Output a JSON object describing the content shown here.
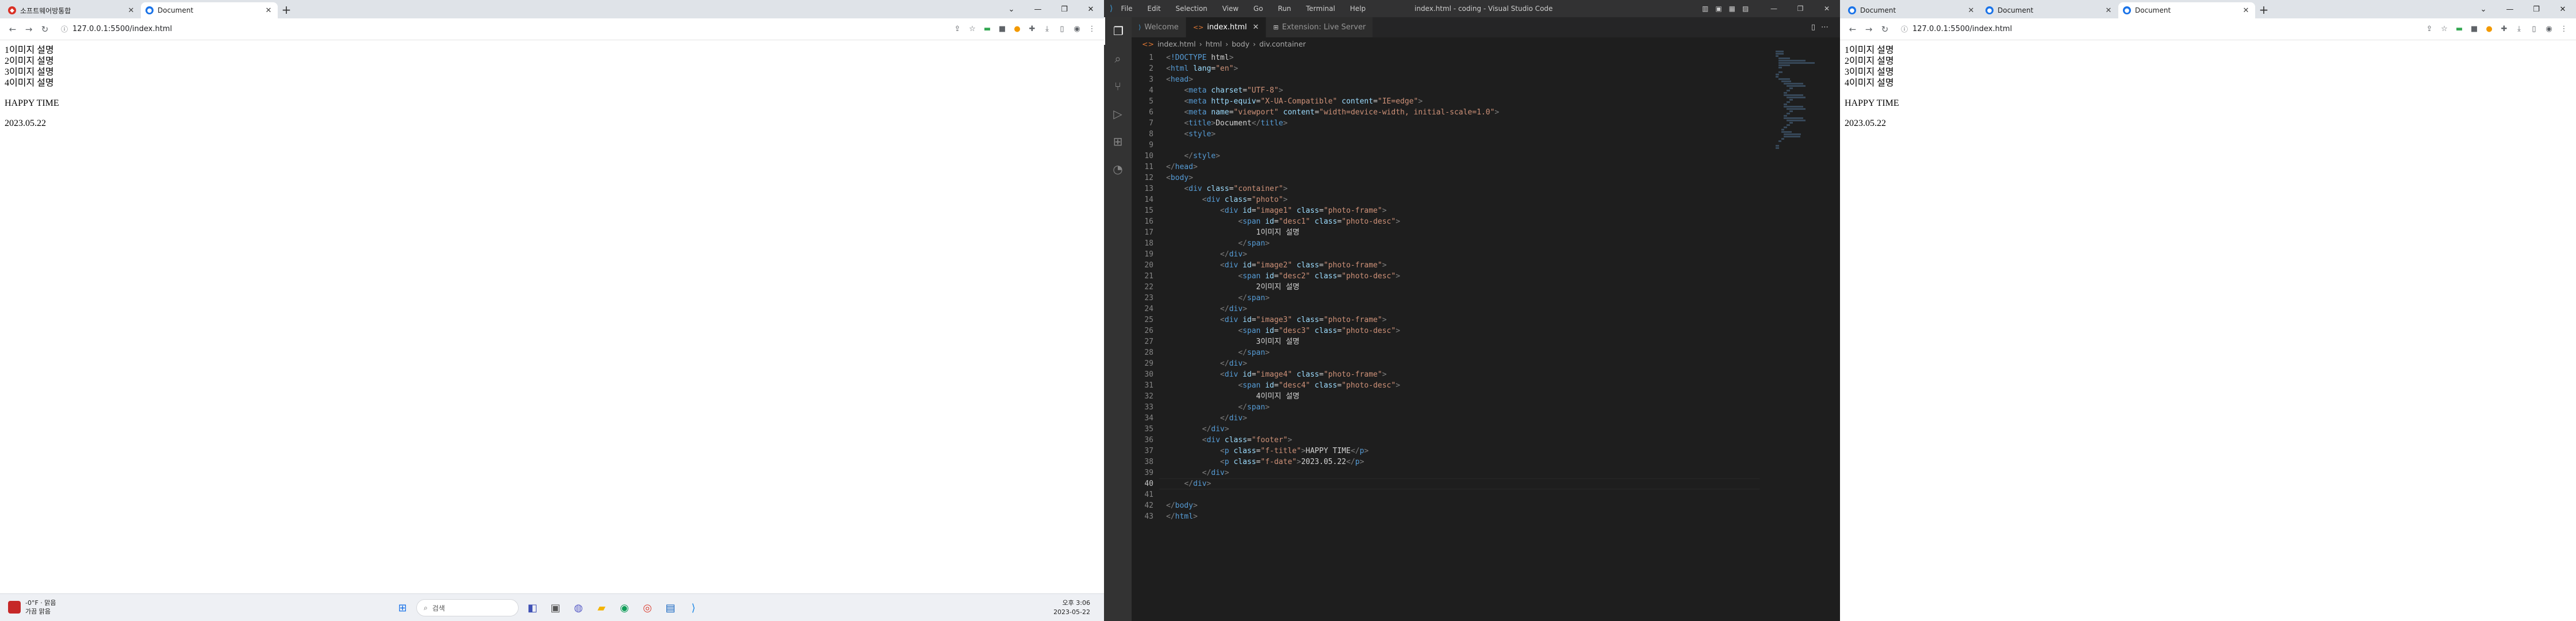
{
  "left_browser": {
    "tabs": [
      {
        "title": "소프트웨어방통합",
        "favicon_color": "#d93025"
      },
      {
        "title": "Document",
        "favicon_color": "#1a73e8"
      }
    ],
    "url": "127.0.0.1:5500/index.html",
    "page": {
      "photo_lines": [
        "1이미지 설명",
        "2이미지 설명",
        "3이미지 설명",
        "4이미지 설명"
      ],
      "title": "HAPPY TIME",
      "date": "2023.05.22"
    }
  },
  "vscode": {
    "menu": [
      "File",
      "Edit",
      "Selection",
      "View",
      "Go",
      "Run",
      "Terminal",
      "Help"
    ],
    "window_title": "index.html - coding - Visual Studio Code",
    "tabs": [
      {
        "label": "Welcome",
        "icon": "vscode-icon"
      },
      {
        "label": "index.html",
        "icon": "html-icon",
        "active": true
      },
      {
        "label": "Extension: Live Server",
        "icon": "extension-icon"
      }
    ],
    "breadcrumb": [
      "index.html",
      "html",
      "body",
      "div.container"
    ],
    "code_lines": [
      "<!DOCTYPE html>",
      "<html lang=\"en\">",
      "<head>",
      "    <meta charset=\"UTF-8\">",
      "    <meta http-equiv=\"X-UA-Compatible\" content=\"IE=edge\">",
      "    <meta name=\"viewport\" content=\"width=device-width, initial-scale=1.0\">",
      "    <title>Document</title>",
      "    <style>",
      "",
      "    </style>",
      "</head>",
      "<body>",
      "    <div class=\"container\">",
      "        <div class=\"photo\">",
      "            <div id=\"image1\" class=\"photo-frame\">",
      "                <span id=\"desc1\" class=\"photo-desc\">",
      "                    1이미지 설명",
      "                </span>",
      "            </div>",
      "            <div id=\"image2\" class=\"photo-frame\">",
      "                <span id=\"desc2\" class=\"photo-desc\">",
      "                    2이미지 설명",
      "                </span>",
      "            </div>",
      "            <div id=\"image3\" class=\"photo-frame\">",
      "                <span id=\"desc3\" class=\"photo-desc\">",
      "                    3이미지 설명",
      "                </span>",
      "            </div>",
      "            <div id=\"image4\" class=\"photo-frame\">",
      "                <span id=\"desc4\" class=\"photo-desc\">",
      "                    4이미지 설명",
      "                </span>",
      "            </div>",
      "        </div>",
      "        <div class=\"footer\">",
      "            <p class=\"f-title\">HAPPY TIME</p>",
      "            <p class=\"f-date\">2023.05.22</p>",
      "        </div>",
      "    </div>",
      "",
      "</body>",
      "</html>"
    ],
    "current_line": 40
  },
  "right_browser": {
    "tabs": [
      {
        "title": "Document",
        "favicon_color": "#1a73e8"
      },
      {
        "title": "Document",
        "favicon_color": "#1a73e8"
      },
      {
        "title": "Document",
        "favicon_color": "#1a73e8"
      }
    ],
    "url": "127.0.0.1:5500/index.html",
    "page": {
      "photo_lines": [
        "1이미지 설명",
        "2이미지 설명",
        "3이미지 설명",
        "4이미지 설명"
      ],
      "title": "HAPPY TIME",
      "date": "2023.05.22"
    }
  },
  "taskbar": {
    "weather_temp": "-0°F · 맑음",
    "weather_desc": "가끔 맑음",
    "search_placeholder": "검색",
    "time": "오후 3:06",
    "date": "2023-05-22"
  }
}
